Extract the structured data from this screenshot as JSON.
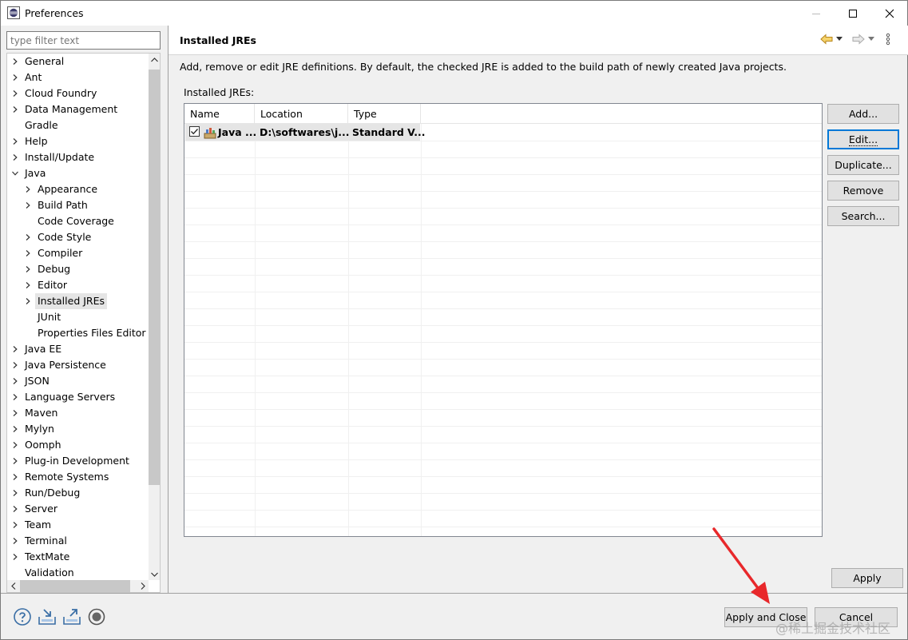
{
  "window": {
    "title": "Preferences",
    "icons": {
      "app": "eclipse-icon",
      "minimize": "minimize-icon",
      "maximize": "maximize-icon",
      "close": "close-icon"
    }
  },
  "filter": {
    "placeholder": "type filter text"
  },
  "tree": {
    "items": [
      {
        "label": "General",
        "expander": "collapsed",
        "level": 0
      },
      {
        "label": "Ant",
        "expander": "collapsed",
        "level": 0
      },
      {
        "label": "Cloud Foundry",
        "expander": "collapsed",
        "level": 0
      },
      {
        "label": "Data Management",
        "expander": "collapsed",
        "level": 0
      },
      {
        "label": "Gradle",
        "expander": "none",
        "level": 0
      },
      {
        "label": "Help",
        "expander": "collapsed",
        "level": 0
      },
      {
        "label": "Install/Update",
        "expander": "collapsed",
        "level": 0
      },
      {
        "label": "Java",
        "expander": "expanded",
        "level": 0
      },
      {
        "label": "Appearance",
        "expander": "collapsed",
        "level": 1
      },
      {
        "label": "Build Path",
        "expander": "collapsed",
        "level": 1
      },
      {
        "label": "Code Coverage",
        "expander": "none",
        "level": 1
      },
      {
        "label": "Code Style",
        "expander": "collapsed",
        "level": 1
      },
      {
        "label": "Compiler",
        "expander": "collapsed",
        "level": 1
      },
      {
        "label": "Debug",
        "expander": "collapsed",
        "level": 1
      },
      {
        "label": "Editor",
        "expander": "collapsed",
        "level": 1
      },
      {
        "label": "Installed JREs",
        "expander": "collapsed",
        "level": 1,
        "selected": true
      },
      {
        "label": "JUnit",
        "expander": "none",
        "level": 1
      },
      {
        "label": "Properties Files Editor",
        "expander": "none",
        "level": 1
      },
      {
        "label": "Java EE",
        "expander": "collapsed",
        "level": 0
      },
      {
        "label": "Java Persistence",
        "expander": "collapsed",
        "level": 0
      },
      {
        "label": "JSON",
        "expander": "collapsed",
        "level": 0
      },
      {
        "label": "Language Servers",
        "expander": "collapsed",
        "level": 0
      },
      {
        "label": "Maven",
        "expander": "collapsed",
        "level": 0
      },
      {
        "label": "Mylyn",
        "expander": "collapsed",
        "level": 0
      },
      {
        "label": "Oomph",
        "expander": "collapsed",
        "level": 0
      },
      {
        "label": "Plug-in Development",
        "expander": "collapsed",
        "level": 0
      },
      {
        "label": "Remote Systems",
        "expander": "collapsed",
        "level": 0
      },
      {
        "label": "Run/Debug",
        "expander": "collapsed",
        "level": 0
      },
      {
        "label": "Server",
        "expander": "collapsed",
        "level": 0
      },
      {
        "label": "Team",
        "expander": "collapsed",
        "level": 0
      },
      {
        "label": "Terminal",
        "expander": "collapsed",
        "level": 0
      },
      {
        "label": "TextMate",
        "expander": "collapsed",
        "level": 0
      },
      {
        "label": "Validation",
        "expander": "none",
        "level": 0
      }
    ]
  },
  "page": {
    "title": "Installed JREs",
    "description": "Add, remove or edit JRE definitions. By default, the checked JRE is added to the build path of newly created Java projects.",
    "list_label": "Installed JREs:",
    "nav_icons": [
      "back-arrow-icon",
      "back-menu-icon",
      "forward-arrow-icon",
      "forward-menu-icon",
      "view-menu-icon"
    ]
  },
  "table": {
    "columns": [
      "Name",
      "Location",
      "Type"
    ],
    "rows": [
      {
        "checked": true,
        "name": "Java ...",
        "location": "D:\\softwares\\j...",
        "type": "Standard V..."
      }
    ]
  },
  "buttons": {
    "add": "Add...",
    "edit": "Edit...",
    "duplicate": "Duplicate...",
    "remove": "Remove",
    "search": "Search...",
    "apply": "Apply",
    "apply_close": "Apply and Close",
    "cancel": "Cancel"
  },
  "footer_icons": [
    "help-icon",
    "import-icon",
    "export-icon",
    "oomph-icon"
  ],
  "watermark": "@稀土掘金技术社区",
  "colors": {
    "selection": "#e5e5e5",
    "focus": "#0078d7",
    "annotation_arrow": "#e8282b"
  }
}
